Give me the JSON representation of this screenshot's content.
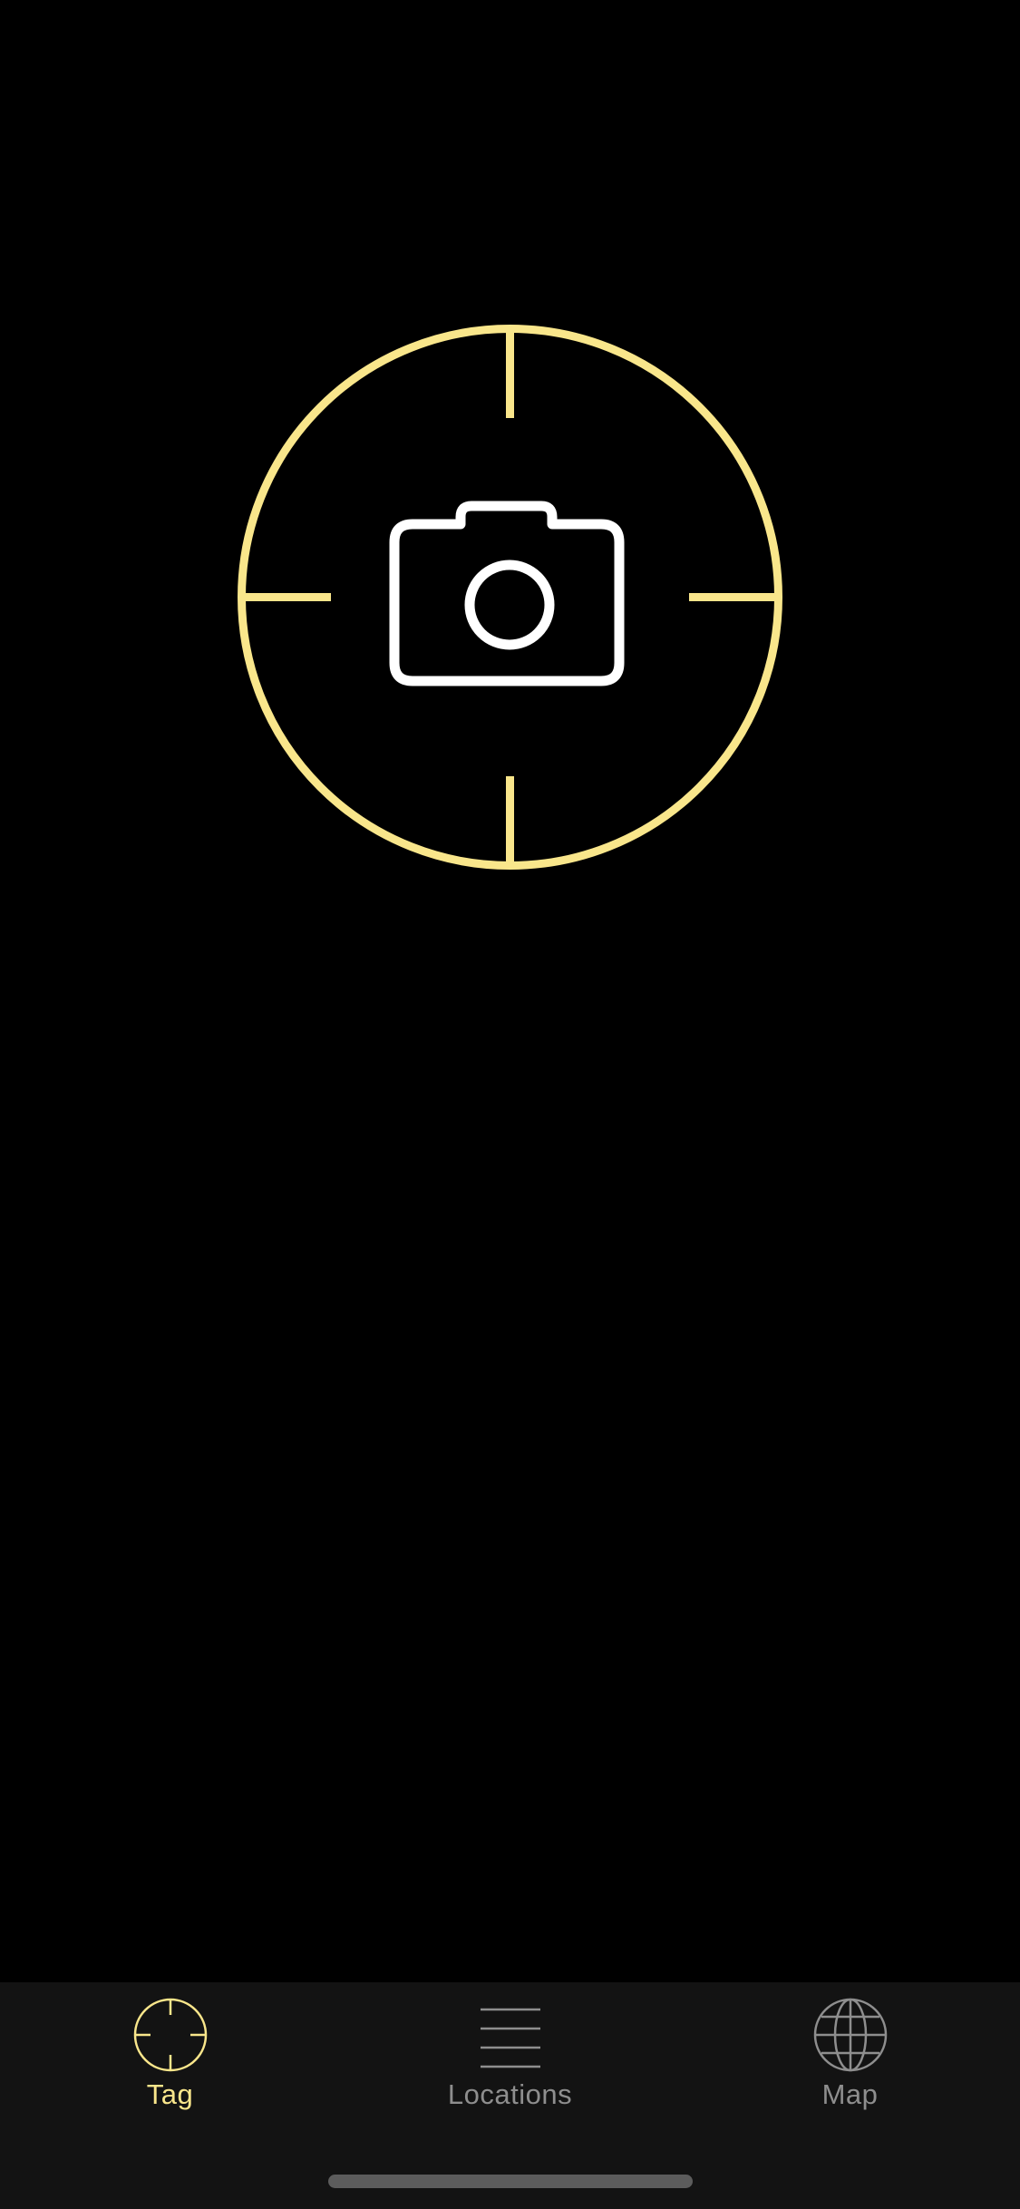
{
  "colors": {
    "background": "#000000",
    "accent": "#f9e68b",
    "camera": "#ffffff",
    "tabbar_background": "#131313",
    "tab_inactive": "#8e8e8e",
    "home_indicator": "#5c5c5c"
  },
  "main": {
    "tag_button": {
      "icon": "crosshair-icon",
      "inner_icon": "camera-icon"
    }
  },
  "tabbar": {
    "selected": "Tag",
    "tabs": [
      {
        "label": "Tag",
        "icon": "crosshair-icon"
      },
      {
        "label": "Locations",
        "icon": "list-icon"
      },
      {
        "label": "Map",
        "icon": "globe-icon"
      }
    ]
  }
}
